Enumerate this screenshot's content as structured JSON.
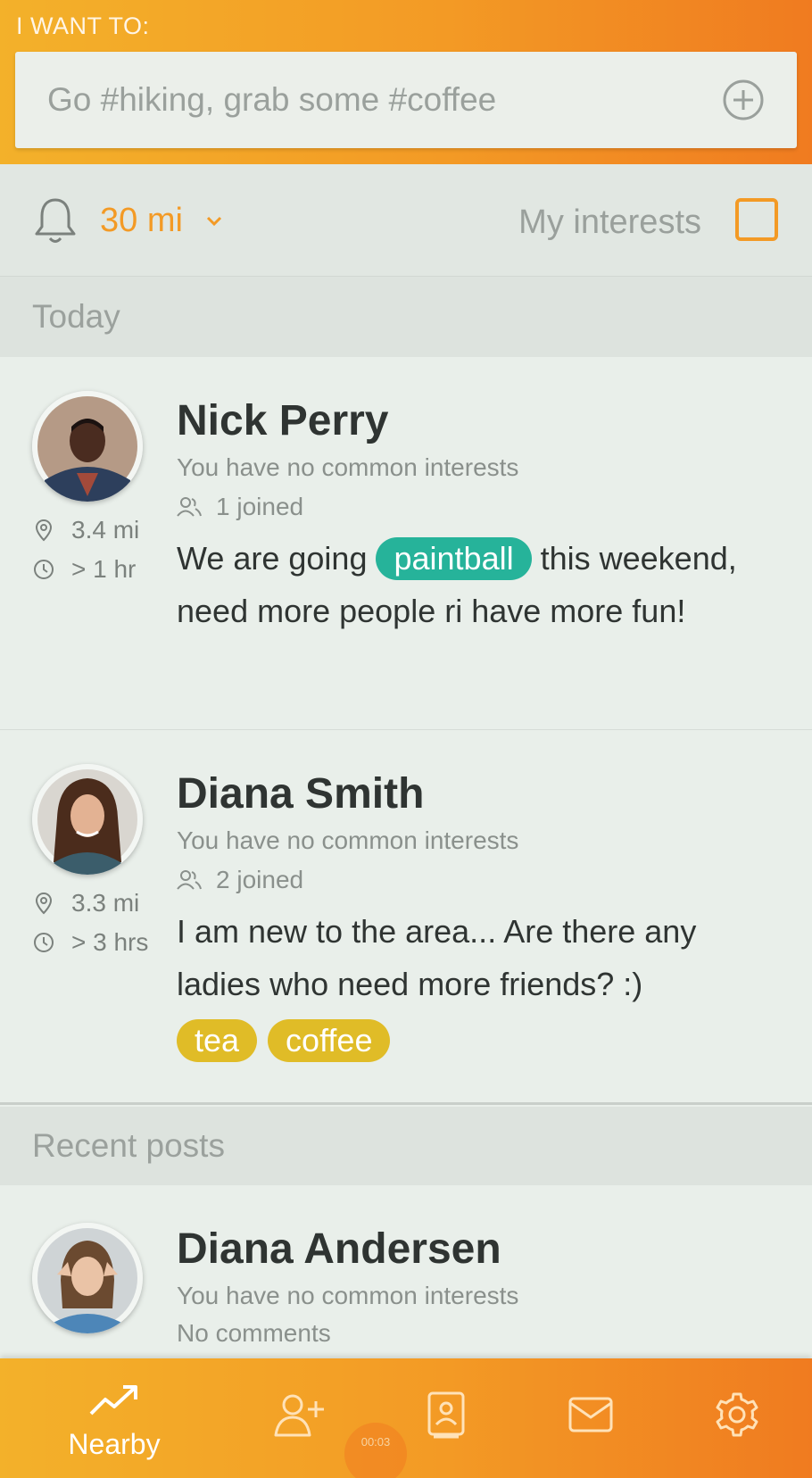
{
  "header": {
    "label": "I WANT TO:",
    "search_placeholder": "Go #hiking, grab some #coffee",
    "add_icon": "plus-circle-icon"
  },
  "filter": {
    "bell_icon": "bell-icon",
    "distance": "30 mi",
    "my_interests_label": "My interests",
    "my_interests_checked": false
  },
  "sections": {
    "today": "Today",
    "recent": "Recent posts"
  },
  "posts_today": [
    {
      "name": "Nick Perry",
      "common": "You have no common interests",
      "joined": "1 joined",
      "distance": "3.4 mi",
      "time": "> 1 hr",
      "msg_before": "We are going",
      "tag": "paintball",
      "msg_after": "this weekend, need more people ri have more fun!"
    },
    {
      "name": "Diana Smith",
      "common": "You have no common interests",
      "joined": "2 joined",
      "distance": "3.3 mi",
      "time": "> 3 hrs",
      "msg": "I am new to the area... Are there any ladies who need more friends? :)",
      "tags": [
        "tea",
        "coffee"
      ]
    }
  ],
  "posts_recent": [
    {
      "name": "Diana Andersen",
      "common": "You have no common interests",
      "comments": "No comments"
    }
  ],
  "nav": {
    "nearby_label": "Nearby",
    "items": [
      "trending-icon",
      "add-friend-icon",
      "contacts-book-icon",
      "mail-icon",
      "gear-icon"
    ]
  },
  "recording_time": "00:03",
  "colors": {
    "accent": "#f39a25",
    "teal_tag": "#26b39a",
    "yellow_tag": "#e0bc27"
  }
}
